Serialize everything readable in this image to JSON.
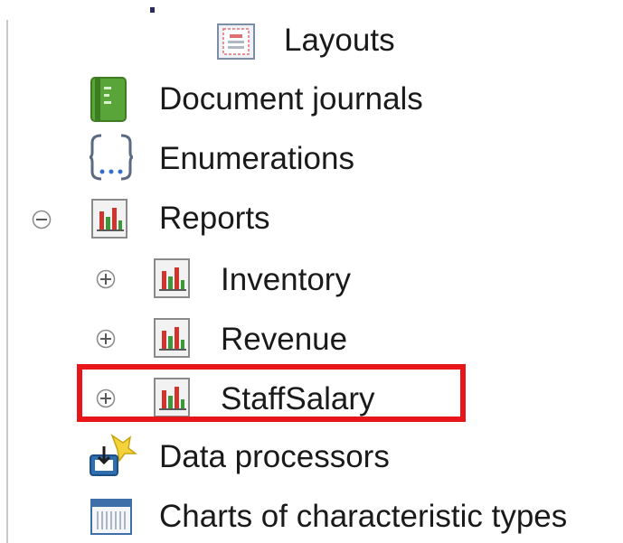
{
  "tree": {
    "items": [
      {
        "label": "Layouts",
        "icon": "layout-icon"
      },
      {
        "label": "Document journals",
        "icon": "journal-icon"
      },
      {
        "label": "Enumerations",
        "icon": "enumeration-icon"
      },
      {
        "label": "Reports",
        "icon": "report-icon",
        "expander": "collapse"
      },
      {
        "label": "Inventory",
        "icon": "report-icon",
        "expander": "expand"
      },
      {
        "label": "Revenue",
        "icon": "report-icon",
        "expander": "expand"
      },
      {
        "label": "StaffSalary",
        "icon": "report-icon",
        "expander": "expand",
        "highlighted": true
      },
      {
        "label": "Data processors",
        "icon": "data-processor-icon"
      },
      {
        "label": "Charts of characteristic types",
        "icon": "chart-of-characteristic-types-icon"
      }
    ]
  },
  "colors": {
    "highlight_border": "#e8161b",
    "journal_green": "#5aa53a",
    "report_red": "#d0342c",
    "report_green": "#3a9a3a"
  }
}
